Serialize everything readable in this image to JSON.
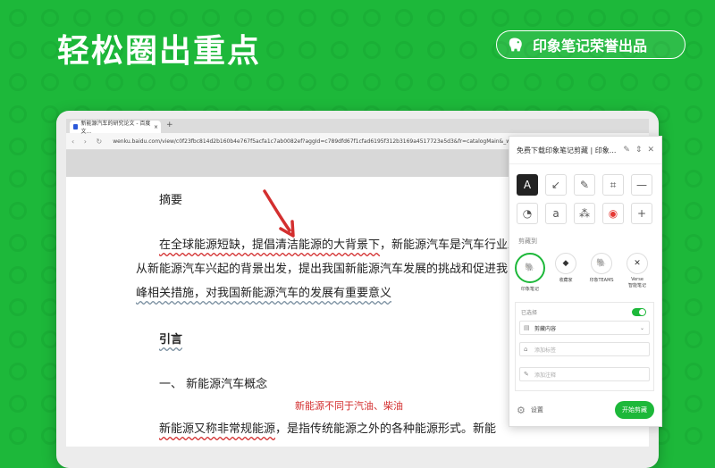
{
  "headline": "轻松圈出重点",
  "brand": {
    "label": "印象笔记荣誉出品",
    "icon": "elephant-icon"
  },
  "browser": {
    "tab_title": "新能源汽车的研究论文 - 百度文...",
    "tab_close": "×",
    "new_tab": "+",
    "nav_buttons": "‹ › ↻",
    "url": "wenku.baidu.com/view/c0f23fbc814d2b160b4e767f5acfa1c7ab0082ef?aggId=c789dfd67f1cfad6195f312b3169a4517723e5d3&fr=catalogMain&_wkts_=..."
  },
  "document": {
    "heading_abstract": "摘要",
    "para1_marked_a": "在全球能源短缺",
    "para1_marked_b": "，提倡清洁能源的大背景下",
    "para1_rest": "，新能源汽车是汽车行业发",
    "para2": "从新能源汽车兴起的背景出发，提出我国新能源汽车发展的挑战和促进我",
    "para3": "峰相关措施，对我国新能源汽车的发展有重要意义",
    "heading_intro": "引言",
    "section1": "一、  新能源汽车概念",
    "annotation": "新能源不同于汽油、柴油",
    "para4_marked": "新能源又称非常规能源",
    "para4_rest": "，是指传统能源之外的各种能源形式。新能"
  },
  "panel": {
    "title": "免费下载印象笔记剪藏 | 印象...",
    "header_icons": [
      "✎",
      "⇕",
      "✕"
    ],
    "tools_row1": [
      "A",
      "↙",
      "✎",
      "⌗",
      "—"
    ],
    "tools_row2": [
      "◔",
      "a",
      "⁂",
      "◉",
      "+"
    ],
    "clip_to_label": "剪藏到",
    "destinations": [
      {
        "label": "印象笔记",
        "glyph": "🐘"
      },
      {
        "label": "收藏家",
        "glyph": "◆"
      },
      {
        "label": "印象TEAMS",
        "glyph": "🐘"
      },
      {
        "label": "Verse",
        "sublabel": "智能笔记",
        "glyph": "✕"
      }
    ],
    "selected_label": "已选择",
    "clip_content": "剪藏内容",
    "add_tags": "添加标签",
    "add_note": "添加注释",
    "settings": "设置",
    "start_button": "开始剪藏"
  },
  "colors": {
    "background": "#1db83a",
    "accent": "#1db83a",
    "annotation": "#d32f2f"
  }
}
